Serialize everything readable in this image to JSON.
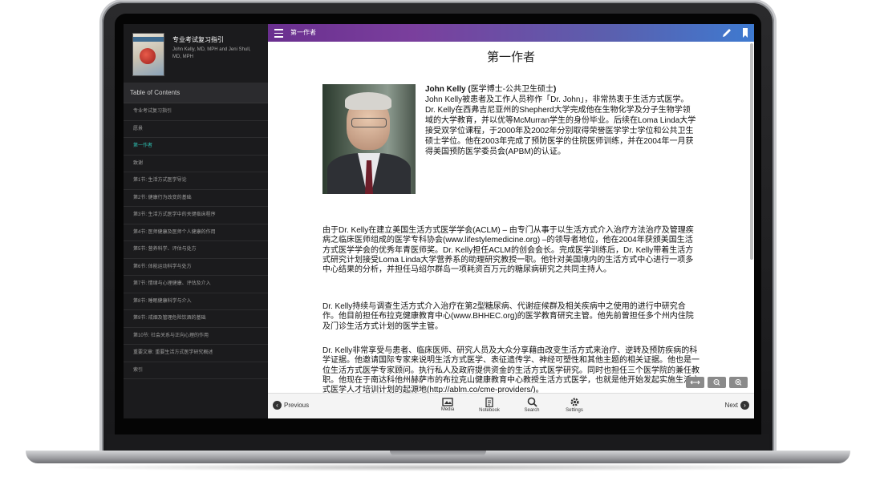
{
  "sidebar": {
    "book_title": "专业考试复习指引",
    "book_authors": "John Kelly, MD, MPH and Jeni Shull, MD, MPH",
    "toc_header": "Table of Contents",
    "items": [
      {
        "label": "专业考试复习指引",
        "active": false
      },
      {
        "label": "愿景",
        "active": false
      },
      {
        "label": "第一作者",
        "active": true
      },
      {
        "label": "致谢",
        "active": false
      },
      {
        "label": "第1节: 生活方式医学导论",
        "active": false
      },
      {
        "label": "第2节: 健康行为改变的基础",
        "active": false
      },
      {
        "label": "第3节: 生活方式医学中的关键临床程序",
        "active": false
      },
      {
        "label": "第4节: 医师健康及医师个人健康的作用",
        "active": false
      },
      {
        "label": "第5节: 营养科学、评估与处方",
        "active": false
      },
      {
        "label": "第6节: 体能运动科学与处方",
        "active": false
      },
      {
        "label": "第7节: 情绪与心理健康、评估及介入",
        "active": false
      },
      {
        "label": "第8节: 睡眠健康科学与介入",
        "active": false
      },
      {
        "label": "第9节: 戒烟及管理危险饮酒的基础",
        "active": false
      },
      {
        "label": "第10节: 社会关系与正向心理的作用",
        "active": false
      },
      {
        "label": "重要文章: 重要生活方式医学研究概述",
        "active": false
      },
      {
        "label": "索引",
        "active": false
      }
    ]
  },
  "topbar": {
    "title": "第一作者"
  },
  "page": {
    "heading": "第一作者",
    "bio_name": "John Kelly (",
    "bio_degree": "医学博士-公共卫生硕士",
    "bio_close": ")",
    "bio_text": "John Kelly被患者及工作人员称作「Dr. John」，非常热衷于生活方式医学。Dr. Kelly在西弗吉尼亚州的Shepherd大学完成他在生物化学及分子生物学领域的大学教育，并以优等McMurran学生的身份毕业。后续在Loma Linda大学接受双学位课程，于2000年及2002年分别取得荣誉医学学士学位和公共卫生硕士学位。他在2003年完成了预防医学的住院医师训练，并在2004年一月获得美国预防医学委员会(APBM)的认证。",
    "para1": "由于Dr. Kelly在建立美国生活方式医学学会(ACLM) – 由专门从事于以生活方式介入治疗方法治疗及管理疾病之临床医师组成的医学专科协会(www.lifestylemedicine.org) –的领导者地位，他在2004年获颁美国生活方式医学学会的优秀年青医师奖。Dr. Kelly担任ACLM的创会会长。完成医学训练后，Dr. Kelly带着生活方式研究计划接受Loma Linda大学营养系的助理研究教授一职。他针对美国境内的生活方式中心进行一项多中心结果的分析，并担任马绍尔群岛一项耗资百万元的糖尿病研究之共同主持人。",
    "para2": "Dr. Kelly持续与调查生活方式介入治疗在第2型糖尿病、代谢症候群及相关疾病中之使用的进行中研究合作。他目前担任布拉克健康教育中心(www.BHHEC.org)的医学教育研究主管。他先前曾担任多个州内住院及门诊生活方式计划的医学主管。",
    "para3": "Dr. Kelly非常享受与患者、临床医师、研究人员及大众分享藉由改变生活方式来治疗、逆转及预防疾病的科学证据。他邀请国际专家来说明生活方式医学、表征遗传学、神经可塑性和其他主题的相关证据。他也是一位生活方式医学专家顾问。执行私人及政府提供资金的生活方式医学研究。同时也担任三个医学院的兼任教职。他现在于南达科他州赫萨市的布拉克山健康教育中心教授生活方式医学，也就是他开始发起实施生活方式医学人才培训计划的起源地(http://ablm.co/cme-providers/)。"
  },
  "bottom": {
    "prev": "Previous",
    "next": "Next",
    "media": "Media",
    "notebook": "Notebook",
    "search": "Search",
    "settings": "Settings"
  },
  "icons": {
    "menu": "hamburger-icon",
    "edit": "pencil-icon",
    "bookmark": "bookmark-icon",
    "fit": "fit-width-icon",
    "zoom_out": "zoom-out-icon",
    "zoom_in": "zoom-in-icon"
  },
  "colors": {
    "accent": "#2ec2b4",
    "topbar_start": "#6a2f8f",
    "topbar_end": "#3e7ad0",
    "sidebar_bg": "#1b1b1d"
  }
}
